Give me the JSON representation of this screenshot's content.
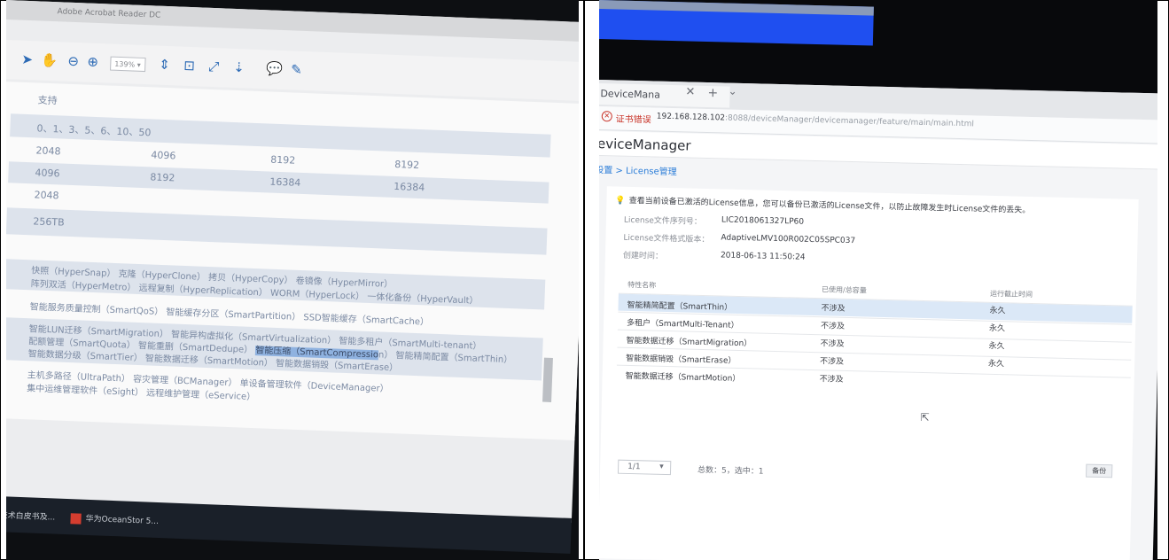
{
  "left": {
    "acrobat": {
      "window_title": "Adobe Acrobat Reader DC",
      "toolbar": {
        "select_icon": "arrow-pointer",
        "hand_icon": "hand",
        "zoom_out_icon": "minus-circle",
        "zoom_in_icon": "plus-circle",
        "zoom_level": "139%",
        "fit_icon": "fit-page",
        "comment_icon": "speech-bubble",
        "pen_icon": "pen"
      },
      "doc": {
        "row_support": "支持",
        "row_raid": "0、1、3、5、6、10、50",
        "row_a": [
          "2048",
          "4096",
          "8192",
          "8192"
        ],
        "row_b": [
          "4096",
          "8192",
          "16384",
          "16384"
        ],
        "row_c": "2048",
        "row_d": "256TB",
        "features_1a": "快照（HyperSnap） 克隆（HyperClone） 拷贝（HyperCopy） 卷镜像（HyperMirror）",
        "features_1b": "阵列双活（HyperMetro） 远程复制（HyperReplication） WORM（HyperLock） 一体化备份（HyperVault）",
        "features_2": "智能服务质量控制（SmartQoS） 智能缓存分区（SmartPartition） SSD智能缓存（SmartCache）",
        "features_3a": "智能LUN迁移（SmartMigration） 智能异构虚拟化（SmartVirtualization） 智能多租户（SmartMulti-tenant）",
        "features_3b_pre": "配额管理（SmartQuota） 智能重删（SmartDedupe） ",
        "features_3b_hl": "智能压缩（SmartCompressio",
        "features_3b_post": "n） 智能精简配置（SmartThin）",
        "features_3c": "智能数据分级（SmartTier） 智能数据迁移（SmartMotion） 智能数据销毁（SmartErase）",
        "features_4a": "主机多路径（UltraPath） 容灾管理（BCManager） 单设备管理软件（DeviceManager）",
        "features_4b": "集中运维管理软件（eSight） 远程维护管理（eService）"
      },
      "taskbar": {
        "item1": "为技术白皮书及...",
        "item2": "华为OceanStor 5..."
      }
    }
  },
  "right": {
    "browser": {
      "tab_label": "DeviceMana",
      "tab_close": "✕",
      "new_tab": "+",
      "tab_menu": "⌄",
      "cert_error": "证书错误",
      "url_host": "192.168.128.102",
      "url_path": ":8088/deviceManager/devicemanager/feature/main/main.html"
    },
    "app": {
      "title": "eviceManager",
      "breadcrumb": "设置 > License管理",
      "tip": "查看当前设备已激活的License信息，您可以备份已激活的License文件，以防止故障发生时License文件的丢失。",
      "license_serial_label": "License文件序列号：",
      "license_serial_value": "LIC20180613​27LP60",
      "license_version_label": "License文件格式版本：",
      "license_version_value": "AdaptiveLMV100R002C05SPC037",
      "created_label": "创建时间：",
      "created_value": "2018-06-13 11:50:24",
      "table": {
        "headers": [
          "特性名称",
          "已使用/总容量",
          "运行截止时间"
        ],
        "rows": [
          [
            "智能精简配置（SmartThin）",
            "不涉及",
            "永久"
          ],
          [
            "多租户（SmartMulti-Tenant）",
            "不涉及",
            "永久"
          ],
          [
            "智能数据迁移（SmartMigration）",
            "不涉及",
            "永久"
          ],
          [
            "智能数据销毁（SmartErase）",
            "不涉及",
            "永久"
          ],
          [
            "智能数据迁移（SmartMotion）",
            "不涉及",
            ""
          ]
        ]
      },
      "pager": {
        "page": "1/1",
        "summary": "总数：5，选中：1"
      },
      "backup_button": "备份"
    }
  }
}
